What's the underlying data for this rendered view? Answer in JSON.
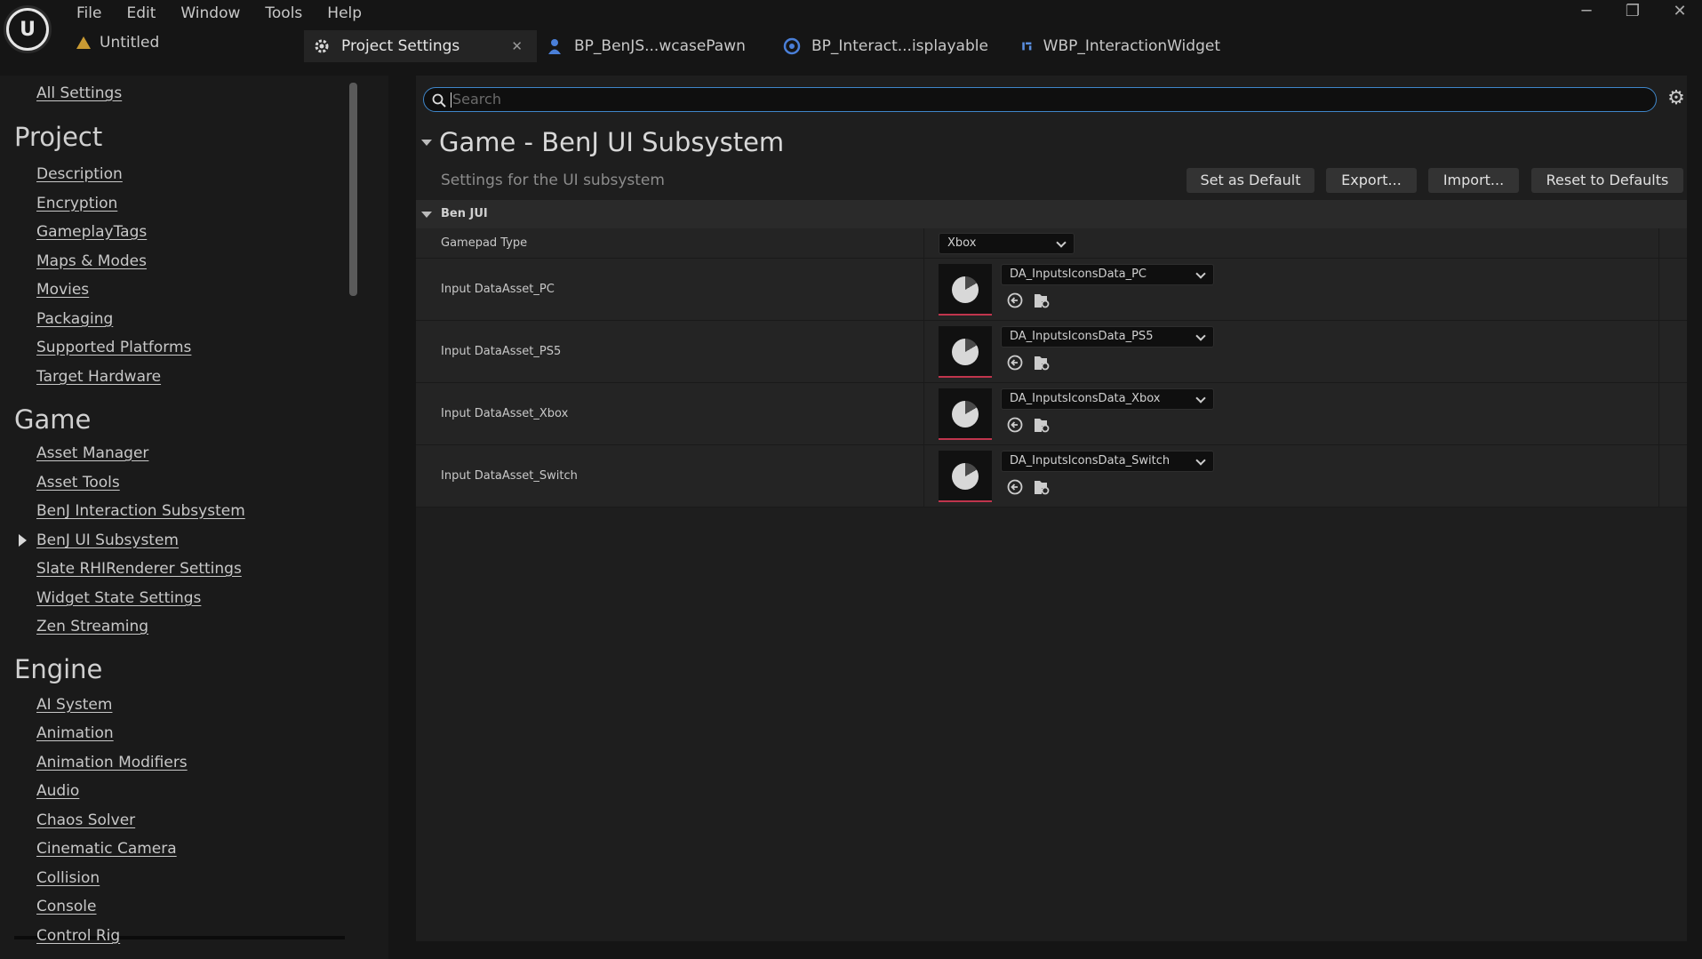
{
  "menu": [
    "File",
    "Edit",
    "Window",
    "Tools",
    "Help"
  ],
  "project": {
    "name": "Untitled"
  },
  "window_controls": {
    "minimize": "─",
    "restore": "❐",
    "close": "✕"
  },
  "tabs": [
    {
      "label": "Project Settings",
      "close": "✕"
    },
    {
      "label": "BP_BenJS...wcasePawn"
    },
    {
      "label": "BP_Interact...isplayable"
    },
    {
      "label": "WBP_InteractionWidget"
    }
  ],
  "sidebar": {
    "all_settings": "All Settings",
    "project": {
      "heading": "Project",
      "items": [
        "Description",
        "Encryption",
        "GameplayTags",
        "Maps & Modes",
        "Movies",
        "Packaging",
        "Supported Platforms",
        "Target Hardware"
      ]
    },
    "game": {
      "heading": "Game",
      "items": [
        "Asset Manager",
        "Asset Tools",
        "BenJ Interaction Subsystem",
        "BenJ UI Subsystem",
        "Slate RHIRenderer Settings",
        "Widget State Settings",
        "Zen Streaming"
      ]
    },
    "engine": {
      "heading": "Engine",
      "items": [
        "AI System",
        "Animation",
        "Animation Modifiers",
        "Audio",
        "Chaos Solver",
        "Cinematic Camera",
        "Collision",
        "Console",
        "Control Rig"
      ]
    }
  },
  "search": {
    "placeholder": "Search"
  },
  "section": {
    "title": "Game - BenJ UI Subsystem",
    "description": "Settings for the UI subsystem",
    "buttons": {
      "set_default": "Set as Default",
      "export": "Export...",
      "import": "Import...",
      "reset": "Reset to Defaults"
    }
  },
  "group": {
    "title": "Ben JUI",
    "gamepad": {
      "label": "Gamepad Type",
      "value": "Xbox"
    },
    "assets": [
      {
        "label": "Input DataAsset_PC",
        "value": "DA_InputsIconsData_PC"
      },
      {
        "label": "Input DataAsset_PS5",
        "value": "DA_InputsIconsData_PS5"
      },
      {
        "label": "Input DataAsset_Xbox",
        "value": "DA_InputsIconsData_Xbox"
      },
      {
        "label": "Input DataAsset_Switch",
        "value": "DA_InputsIconsData_Switch"
      }
    ]
  },
  "colors": {
    "accent_blue": "#3f86c9",
    "thumb_underline": "#c0354d",
    "project_icon": "#c99a33"
  }
}
